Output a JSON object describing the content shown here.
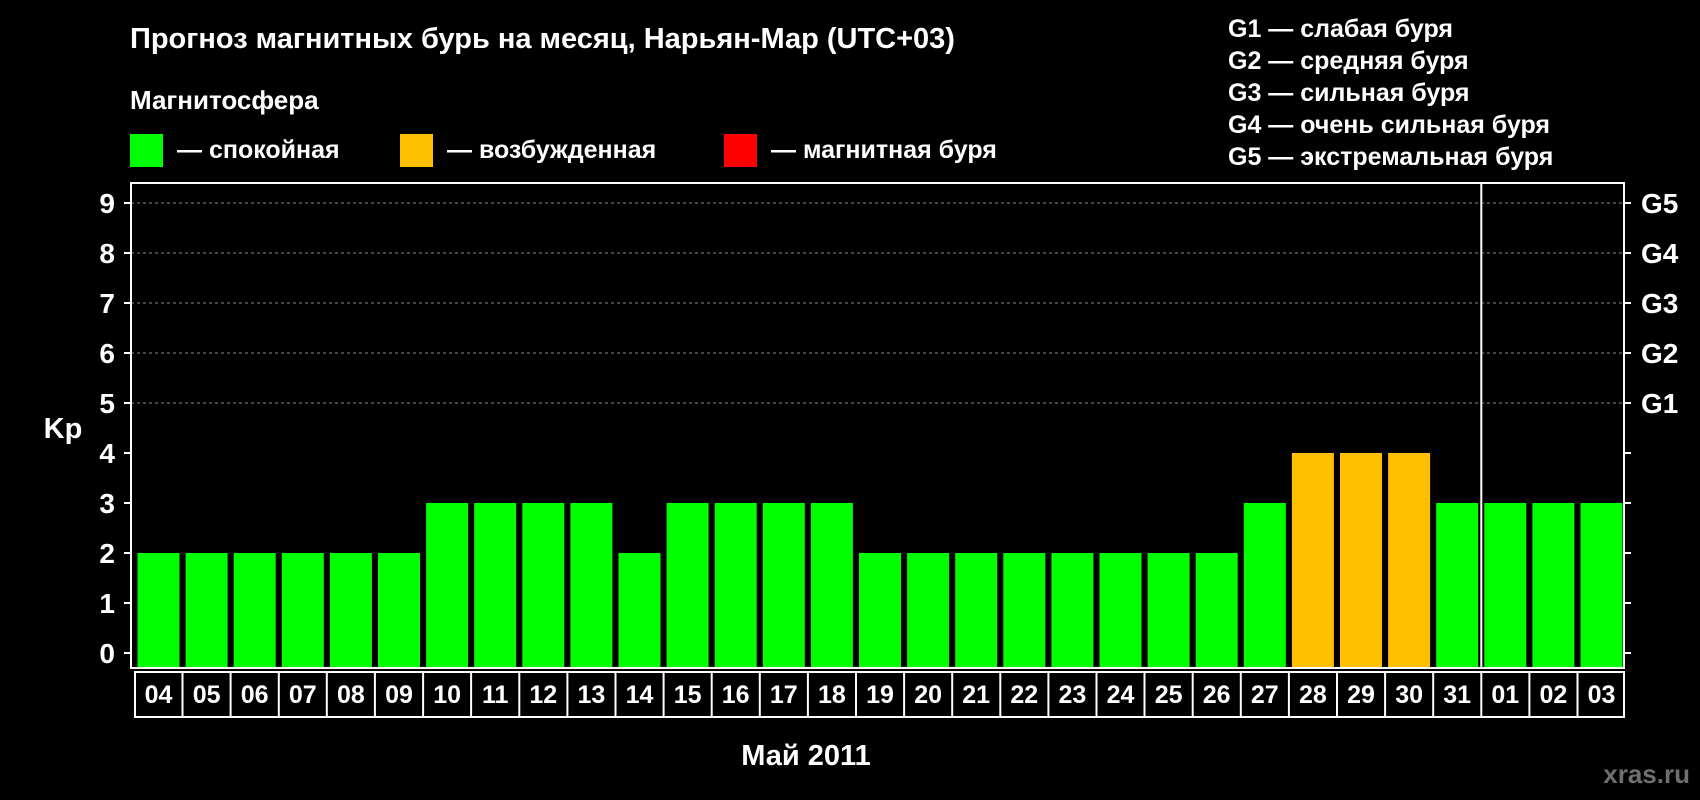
{
  "title": "Прогноз магнитных бурь на месяц, Нарьян-Мар (UTC+03)",
  "legend": {
    "heading": "Магнитосфера",
    "items": [
      {
        "label": "— спокойная",
        "color": "#00ff00"
      },
      {
        "label": "— возбужденная",
        "color": "#ffc000"
      },
      {
        "label": "— магнитная буря",
        "color": "#ff0000"
      }
    ]
  },
  "storm_scale": [
    "G1 — слабая буря",
    "G2 — средняя буря",
    "G3 — сильная буря",
    "G4 — очень сильная буря",
    "G5 — экстремальная буря"
  ],
  "watermark": "xras.ru",
  "chart_data": {
    "type": "bar",
    "title": "Прогноз магнитных бурь на месяц, Нарьян-Мар (UTC+03)",
    "xlabel": "Май 2011",
    "ylabel": "Kp",
    "ylim": [
      0,
      9
    ],
    "yticks": [
      0,
      1,
      2,
      3,
      4,
      5,
      6,
      7,
      8,
      9
    ],
    "right_axis_labels": [
      {
        "kp": 5,
        "label": "G1"
      },
      {
        "kp": 6,
        "label": "G2"
      },
      {
        "kp": 7,
        "label": "G3"
      },
      {
        "kp": 8,
        "label": "G4"
      },
      {
        "kp": 9,
        "label": "G5"
      }
    ],
    "grid": "dashed horizontal at Kp 5–9",
    "month_divider_before": "01",
    "categories": [
      "04",
      "05",
      "06",
      "07",
      "08",
      "09",
      "10",
      "11",
      "12",
      "13",
      "14",
      "15",
      "16",
      "17",
      "18",
      "19",
      "20",
      "21",
      "22",
      "23",
      "24",
      "25",
      "26",
      "27",
      "28",
      "29",
      "30",
      "31",
      "01",
      "02",
      "03"
    ],
    "values": [
      2,
      2,
      2,
      2,
      2,
      2,
      3,
      3,
      3,
      3,
      2,
      3,
      3,
      3,
      3,
      2,
      2,
      2,
      2,
      2,
      2,
      2,
      2,
      3,
      4,
      4,
      4,
      3,
      3,
      3,
      3
    ],
    "color_rule": {
      "quiet_max": 3,
      "active_max": 4
    },
    "colors": {
      "quiet": "#00ff00",
      "active": "#ffc000",
      "storm": "#ff0000"
    }
  }
}
